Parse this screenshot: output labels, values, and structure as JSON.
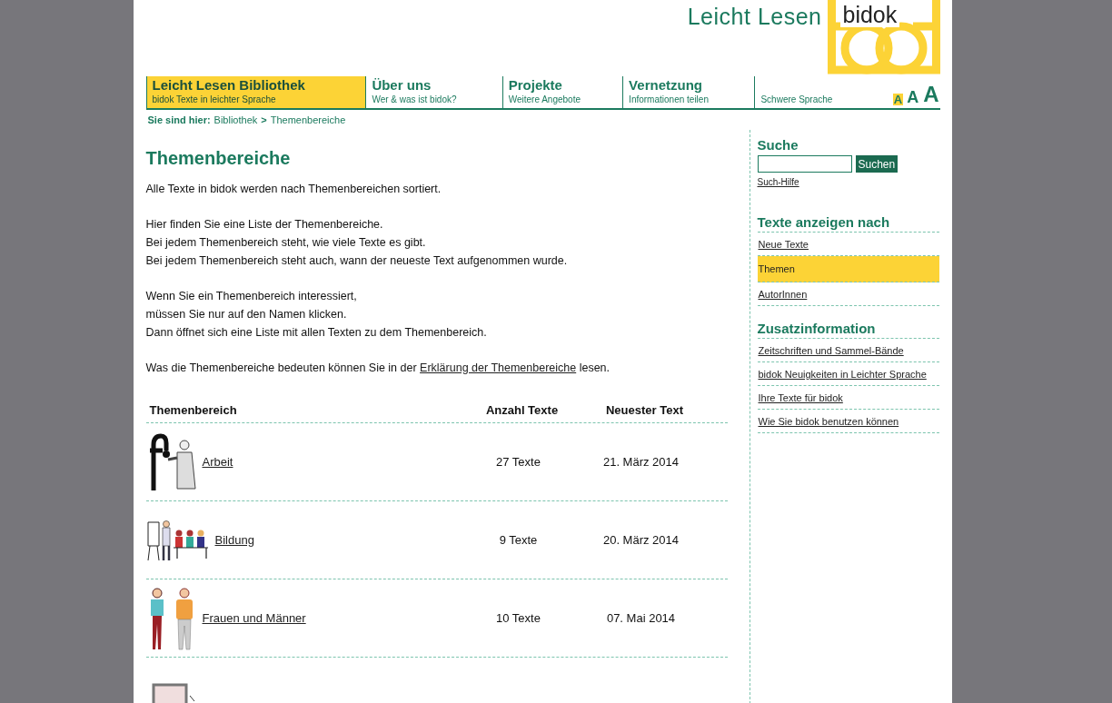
{
  "logo": {
    "text": "Leicht Lesen",
    "brand": "bidok"
  },
  "nav": [
    {
      "title": "Leicht Lesen Bibliothek",
      "subtitle": "bidok Texte in leichter Sprache",
      "selected": true
    },
    {
      "title": "Über uns",
      "subtitle": "Wer & was ist bidok?",
      "selected": false
    },
    {
      "title": "Projekte",
      "subtitle": "Weitere Angebote",
      "selected": false
    },
    {
      "title": "Vernetzung",
      "subtitle": "Informationen teilen",
      "selected": false
    },
    {
      "subtitle": "Schwere Sprache",
      "selected": false
    }
  ],
  "font_sizes": [
    {
      "label": "A",
      "selected": true
    },
    {
      "label": "A",
      "selected": false
    },
    {
      "label": "A",
      "selected": false
    }
  ],
  "breadcrumb": {
    "label": "Sie sind hier:",
    "items": [
      "Bibliothek",
      "Themenbereiche"
    ],
    "separator": ">"
  },
  "heading": "Themenbereiche",
  "paragraphs": [
    [
      "Alle Texte in bidok werden nach Themenbereichen sortiert."
    ],
    [
      "Hier finden Sie eine Liste der Themenbereiche.",
      "Bei jedem Themenbereich steht, wie viele Texte es gibt.",
      "Bei jedem Themenbereich steht auch, wann der neueste Text aufgenommen wurde."
    ],
    [
      "Wenn Sie ein Themenbereich interessiert,",
      "müssen Sie nur auf den Namen klicken.",
      "Dann öffnet sich eine Liste mit allen Texten zu dem Themenbereich."
    ]
  ],
  "explanation": {
    "before": "Was die Themenbereiche bedeuten können Sie in der",
    "link": "Erklärung der Themenbereiche",
    "after": "lesen."
  },
  "table": {
    "columns": [
      "Themenbereich",
      "Anzahl Texte",
      "Neuester Text"
    ],
    "rows": [
      {
        "kind": "work",
        "name": "Arbeit",
        "count": "27 Texte",
        "date": "21. März 2014"
      },
      {
        "kind": "education",
        "name": "Bildung",
        "count": "9 Texte",
        "date": "20. März 2014"
      },
      {
        "kind": "people",
        "name": "Frauen und Männer",
        "count": "10 Texte",
        "date": "07. Mai 2014"
      },
      {
        "kind": "board"
      }
    ]
  },
  "sidebar": {
    "search": {
      "title": "Suche",
      "button": "Suchen",
      "help": "Such-Hilfe"
    },
    "sections": [
      {
        "title": "Texte anzeigen nach",
        "items": [
          {
            "label": "Neue Texte",
            "selected": false
          },
          {
            "label": "Themen",
            "selected": true
          },
          {
            "label": "AutorInnen",
            "selected": false
          }
        ]
      },
      {
        "title": "Zusatzinformation",
        "items": [
          {
            "label": "Zeitschriften und Sammel-Bände",
            "selected": false
          },
          {
            "label": "bidok Neuigkeiten in Leichter Sprache",
            "selected": false
          },
          {
            "label": "Ihre Texte für bidok",
            "selected": false
          },
          {
            "label": "Wie Sie bidok benutzen können",
            "selected": false
          }
        ]
      }
    ]
  }
}
